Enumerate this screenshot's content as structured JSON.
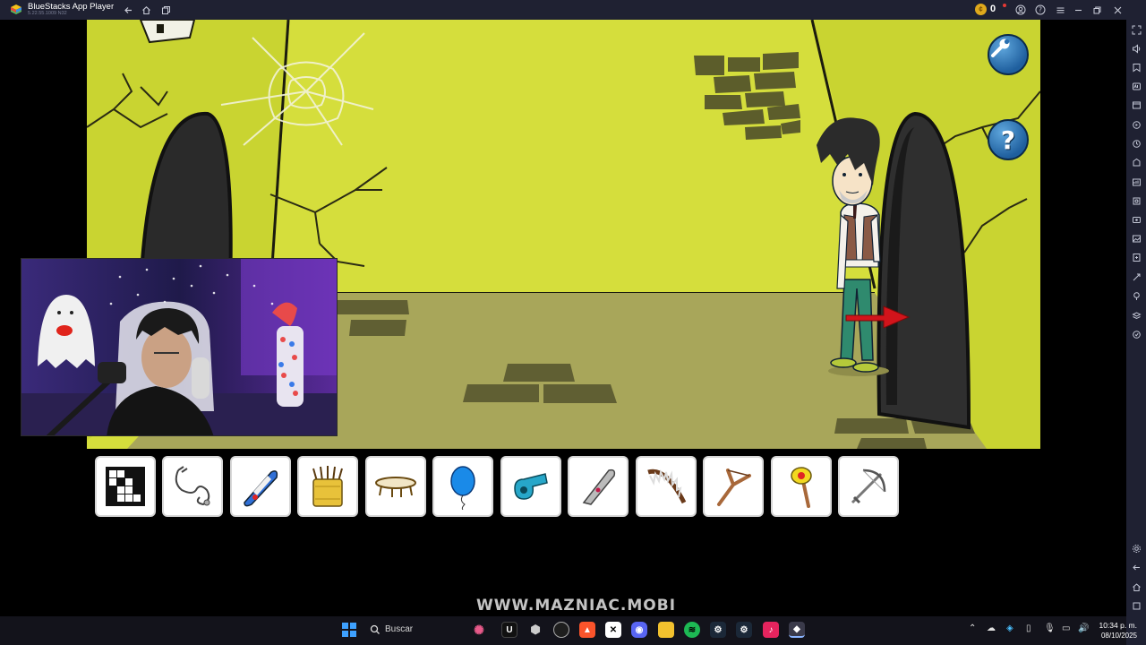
{
  "window": {
    "app_title": "BlueStacks App Player",
    "app_version": "5.22.55.1009 N32",
    "coins": "0"
  },
  "titlebar_icons": [
    "back-icon",
    "home-icon",
    "multi-instance-icon",
    "coin-icon",
    "account-icon",
    "help-circle-icon",
    "menu-icon",
    "minimize-icon",
    "restore-icon",
    "close-icon"
  ],
  "sidebar_icons": [
    "fullscreen-icon",
    "volume-icon",
    "keyboard-controls-icon",
    "ad-icon",
    "macro-icon",
    "rotate-icon",
    "performance-icon",
    "screenshot-icon",
    "record-icon",
    "media-icon",
    "apk-icon",
    "shake-icon",
    "location-icon",
    "eco-mode-icon",
    "sync-icon",
    "settings-icon",
    "android-back-icon",
    "android-home-icon",
    "android-recents-icon"
  ],
  "game": {
    "settings_button": "wrench-icon",
    "help_button_label": "?",
    "exit_arrow": "red-arrow-icon"
  },
  "inventory": {
    "items": [
      {
        "name": "crossword-puzzle-item"
      },
      {
        "name": "stethoscope-item"
      },
      {
        "name": "skateboard-item"
      },
      {
        "name": "pencil-can-item"
      },
      {
        "name": "trampoline-item"
      },
      {
        "name": "balloon-item"
      },
      {
        "name": "whistle-item"
      },
      {
        "name": "knife-item"
      },
      {
        "name": "bear-trap-item"
      },
      {
        "name": "slingshot-item"
      },
      {
        "name": "torch-item"
      },
      {
        "name": "crossbow-item"
      }
    ]
  },
  "watermark": "WWW.MAZNIAC.MOBI",
  "taskbar": {
    "search_label": "Buscar",
    "time": "10:34 p. m.",
    "date": "08/10/2025"
  },
  "colors": {
    "wall": "#d5de3c",
    "floor": "#a8a65a",
    "titlebar": "#1f2132",
    "help_button": "#2a6fb0"
  }
}
